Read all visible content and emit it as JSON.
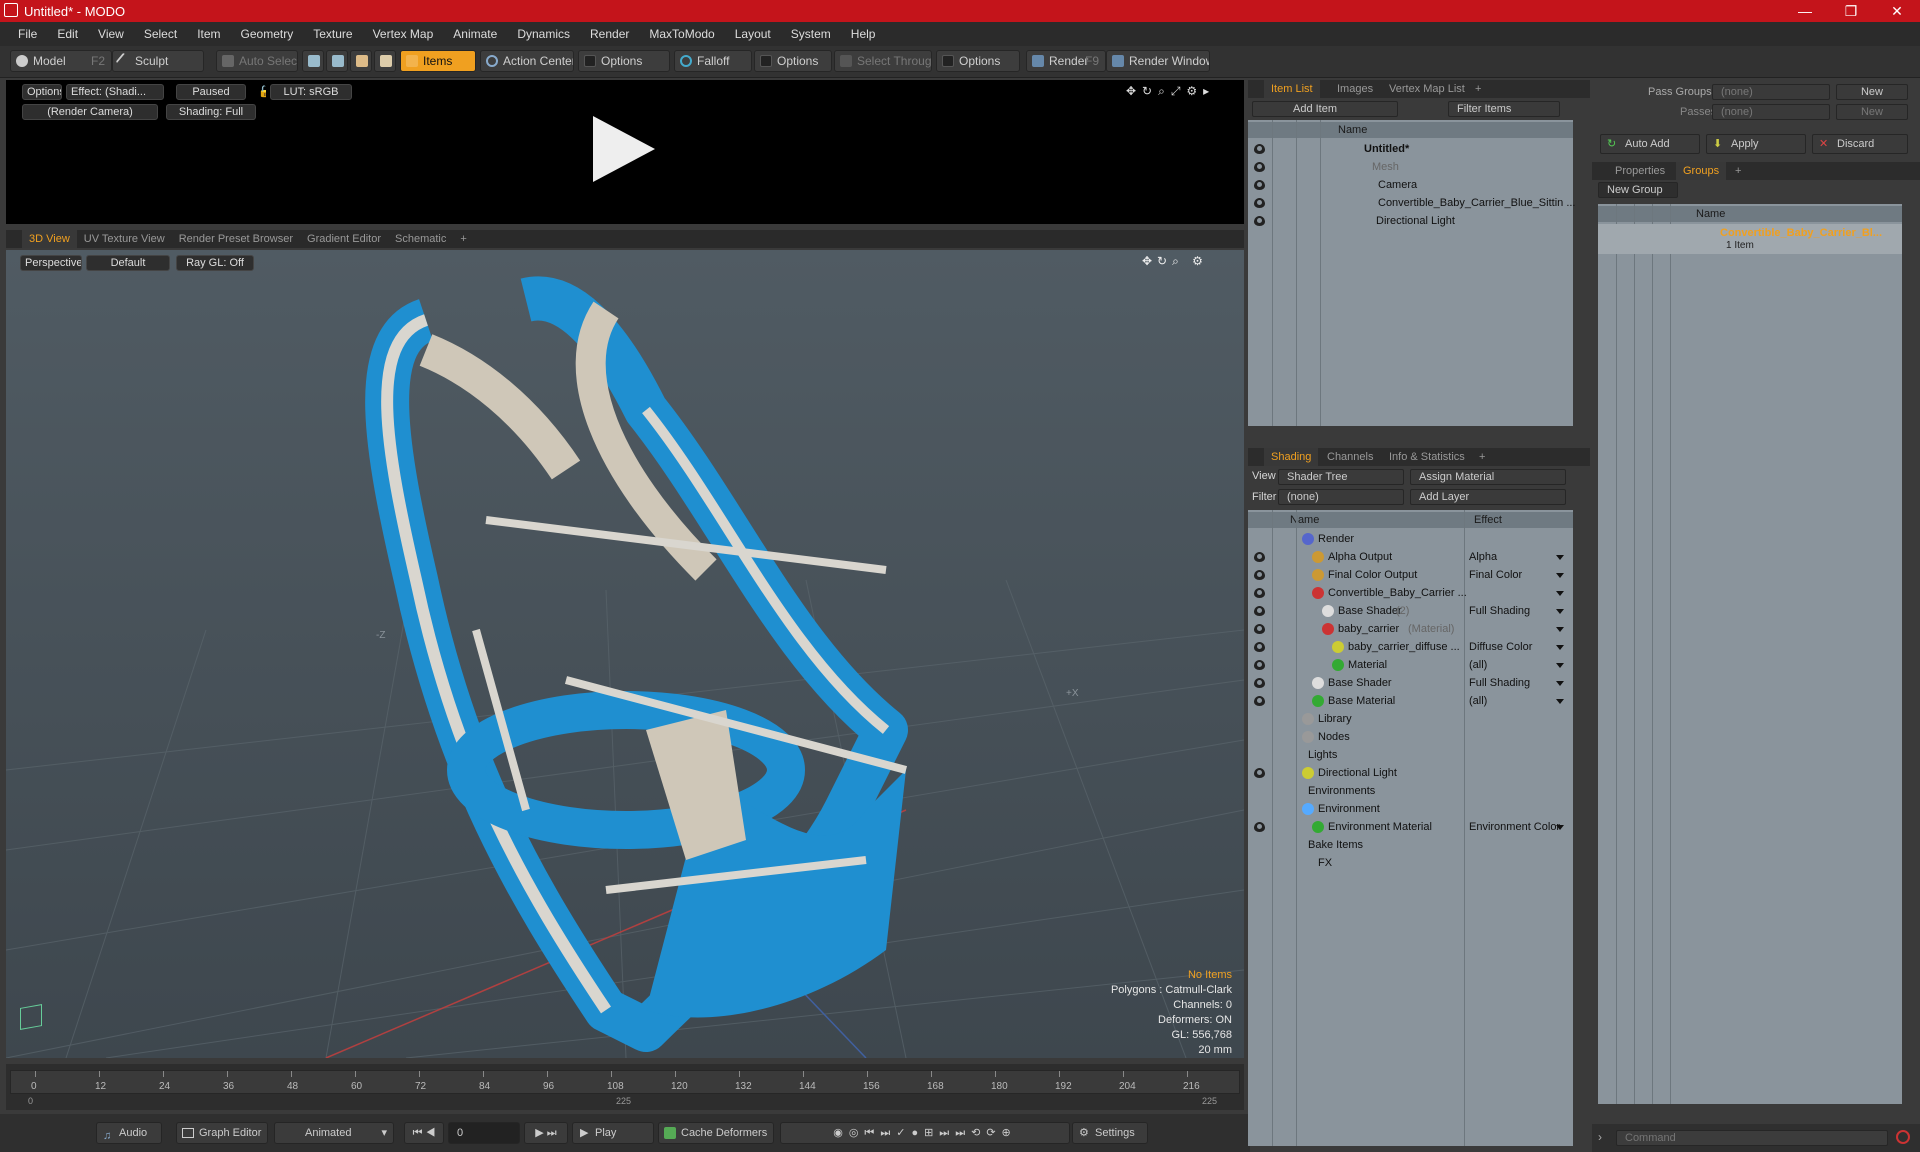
{
  "app": {
    "title": "Untitled* - MODO",
    "accent": "#f0a020",
    "titlebar_color": "#c4141b"
  },
  "window": {
    "minimize": "—",
    "maximize": "❐",
    "close": "✕"
  },
  "menu": [
    "File",
    "Edit",
    "View",
    "Select",
    "Item",
    "Geometry",
    "Texture",
    "Vertex Map",
    "Animate",
    "Dynamics",
    "Render",
    "MaxToModo",
    "Layout",
    "System",
    "Help"
  ],
  "toolbar": {
    "model": "Model",
    "model_key": "F2",
    "sculpt": "Sculpt",
    "auto_select": "Auto Select",
    "items": "Items",
    "action_center": "Action Center",
    "options1": "Options",
    "falloff": "Falloff",
    "options2": "Options",
    "select_through": "Select Through",
    "options3": "Options",
    "render": "Render",
    "render_key": "F9",
    "render_window": "Render Window"
  },
  "preview": {
    "options": "Options",
    "effect": "Effect: (Shadi...",
    "paused": "Paused",
    "lut": "LUT: sRGB",
    "camera": "(Render Camera)",
    "shading": "Shading: Full"
  },
  "viewport_tabs": [
    "3D View",
    "UV Texture View",
    "Render Preset Browser",
    "Gradient Editor",
    "Schematic",
    "+"
  ],
  "viewport": {
    "perspective": "Perspective",
    "default": "Default",
    "raygl": "Ray GL: Off",
    "axis_z": "-Z",
    "axis_x": "+X",
    "info": [
      "No Items",
      "Polygons : Catmull-Clark",
      "Channels: 0",
      "Deformers: ON",
      "GL: 556,768",
      "20 mm"
    ]
  },
  "timeline": {
    "ticks": [
      "0",
      "12",
      "24",
      "36",
      "48",
      "60",
      "72",
      "84",
      "96",
      "108",
      "120",
      "132",
      "144",
      "156",
      "168",
      "180",
      "192",
      "204",
      "216"
    ],
    "start": "0",
    "mid": "225",
    "end": "225"
  },
  "bottom": {
    "audio": "Audio",
    "graph_editor": "Graph Editor",
    "animated": "Animated",
    "frame": "0",
    "play": "Play",
    "cache": "Cache Deformers",
    "settings": "Settings"
  },
  "itemlist": {
    "tabs": [
      "Item List",
      "Images",
      "Vertex Map List",
      "+"
    ],
    "add_item": "Add Item",
    "filter": "Filter Items",
    "name_col": "Name",
    "rows": [
      {
        "label": "Untitled*"
      },
      {
        "label": "Mesh"
      },
      {
        "label": "Camera"
      },
      {
        "label": "Convertible_Baby_Carrier_Blue_Sittin ..."
      },
      {
        "label": "Directional Light"
      }
    ]
  },
  "shading": {
    "tabs": [
      "Shading",
      "Channels",
      "Info & Statistics",
      "+"
    ],
    "view_label": "View",
    "view_value": "Shader Tree",
    "assign": "Assign Material",
    "filter_label": "Filter",
    "filter_value": "(none)",
    "add_layer": "Add Layer",
    "name_col": "Name",
    "effect_col": "Effect",
    "rows": [
      {
        "label": "Render",
        "effect": ""
      },
      {
        "label": "Alpha Output",
        "effect": "Alpha"
      },
      {
        "label": "Final Color Output",
        "effect": "Final Color"
      },
      {
        "label": "Convertible_Baby_Carrier ...",
        "effect": ""
      },
      {
        "label": "Base Shader",
        "extra": "(2)",
        "effect": "Full Shading"
      },
      {
        "label": "baby_carrier",
        "extra": "(Material)",
        "effect": ""
      },
      {
        "label": "baby_carrier_diffuse ...",
        "effect": "Diffuse Color"
      },
      {
        "label": "Material",
        "effect": "(all)"
      },
      {
        "label": "Base Shader",
        "effect": "Full Shading"
      },
      {
        "label": "Base Material",
        "effect": "(all)"
      },
      {
        "label": "Library",
        "effect": ""
      },
      {
        "label": "Nodes",
        "effect": ""
      },
      {
        "label": "Lights",
        "effect": ""
      },
      {
        "label": "Directional Light",
        "effect": ""
      },
      {
        "label": "Environments",
        "effect": ""
      },
      {
        "label": "Environment",
        "effect": ""
      },
      {
        "label": "Environment Material",
        "effect": "Environment Color"
      },
      {
        "label": "Bake Items",
        "effect": ""
      },
      {
        "label": "FX",
        "effect": ""
      }
    ]
  },
  "groups": {
    "pass_groups": "Pass Groups",
    "pass_value": "(none)",
    "new": "New",
    "passes": "Passes",
    "passes_value": "(none)",
    "new2": "New",
    "auto_add": "Auto Add",
    "apply": "Apply",
    "discard": "Discard",
    "tabs": [
      "Properties",
      "Groups",
      "+"
    ],
    "new_group": "New Group",
    "name_col": "Name",
    "group_name": "Convertible_Baby_Carrier_Bl...",
    "group_count": "1 Item"
  },
  "command": {
    "placeholder": "Command"
  }
}
